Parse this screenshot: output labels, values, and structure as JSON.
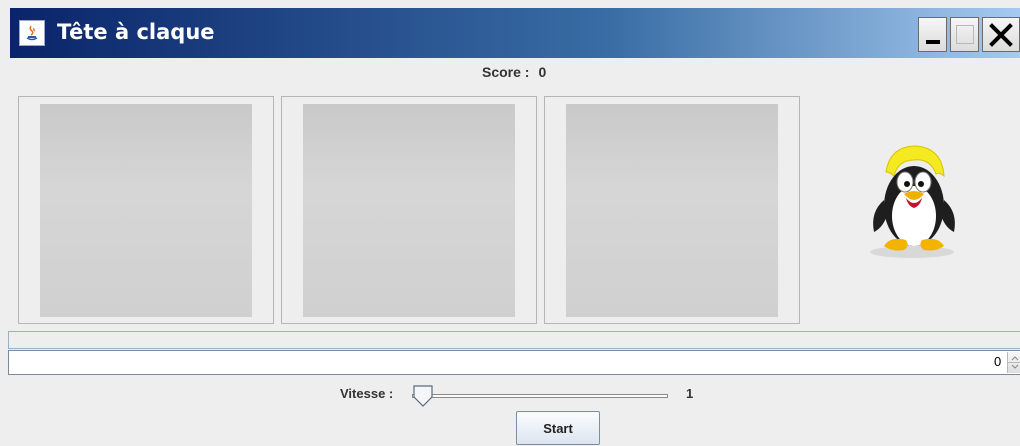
{
  "window": {
    "title": "Tête à claque",
    "controls": {
      "minimize_icon": "minimize-icon",
      "maximize_icon": "maximize-icon",
      "close_label": "X"
    }
  },
  "score": {
    "label": "Score :",
    "value": "0"
  },
  "grid": {
    "cells": [
      {
        "state": "empty"
      },
      {
        "state": "empty"
      },
      {
        "state": "empty"
      }
    ]
  },
  "mascot": {
    "icon": "tux-penguin-icon"
  },
  "progress": {
    "value": 0
  },
  "text_row": {
    "spinner_value": "0"
  },
  "speed": {
    "label": "Vitesse :",
    "value": "1",
    "level": 0
  },
  "start_button": {
    "label": "Start"
  },
  "colors": {
    "titlebar_start": "#0a246a",
    "titlebar_end": "#a6caf0",
    "background": "#eeeeee",
    "cell_fill": "#d0d0d0"
  }
}
